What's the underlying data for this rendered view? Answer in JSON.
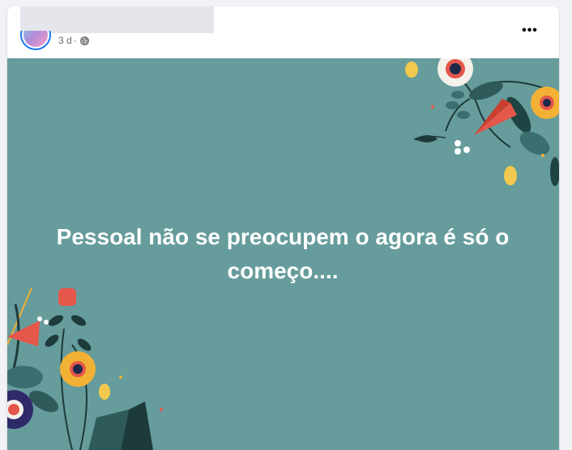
{
  "post": {
    "timestamp": "3 d",
    "separator": "·",
    "privacy_icon": "globe-icon",
    "more_icon": "more-options-icon",
    "more_label": "•••",
    "text": "Pessoal não se preocupem o agora é só o começo...."
  },
  "colors": {
    "background": "#f0f2f5",
    "card": "#ffffff",
    "post_bg": "#669c9c",
    "meta_text": "#65676b"
  }
}
